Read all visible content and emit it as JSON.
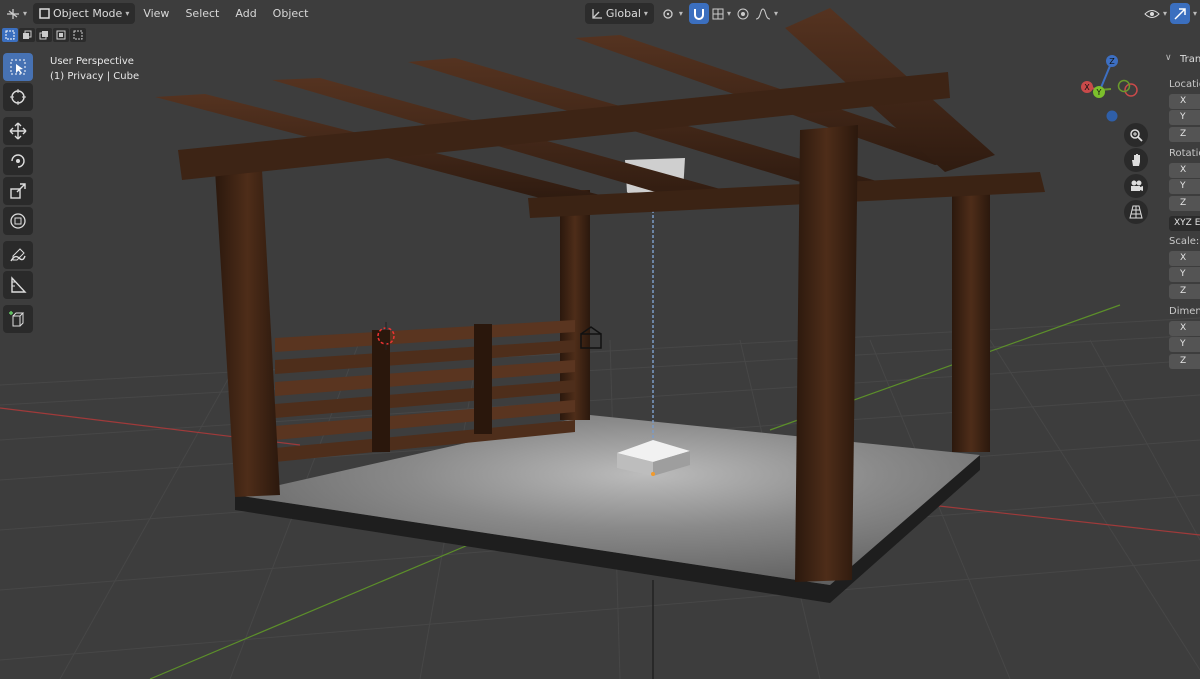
{
  "header": {
    "mode_label": "Object Mode",
    "menus": [
      "View",
      "Select",
      "Add",
      "Object"
    ],
    "orientation_label": "Global"
  },
  "viewport": {
    "view_name": "User Perspective",
    "collection_line": "(1) Privacy | Cube"
  },
  "gizmo": {
    "axes": [
      "X",
      "Y",
      "Z"
    ]
  },
  "n_panel": {
    "tab_title": "Tran",
    "location_label": "Locatio",
    "rotation_label": "Rotatio",
    "rotation_mode": "XYZ E",
    "scale_label": "Scale:",
    "dimensions_label": "Dimens",
    "axis_x": "X",
    "axis_y": "Y",
    "axis_z": "Z"
  },
  "colors": {
    "accent": "#3b6fbf",
    "viewport_bg": "#3d3d3d",
    "grid_line": "#474747",
    "axis_x": "#a03a3a",
    "axis_y": "#5c8f2a",
    "wood": "#3b2315",
    "floor": "#8f8f8f"
  },
  "toolbar": {
    "tools": [
      "select-box",
      "cursor",
      "move",
      "rotate",
      "scale",
      "transform",
      "annotate",
      "measure",
      "add-cube"
    ]
  }
}
